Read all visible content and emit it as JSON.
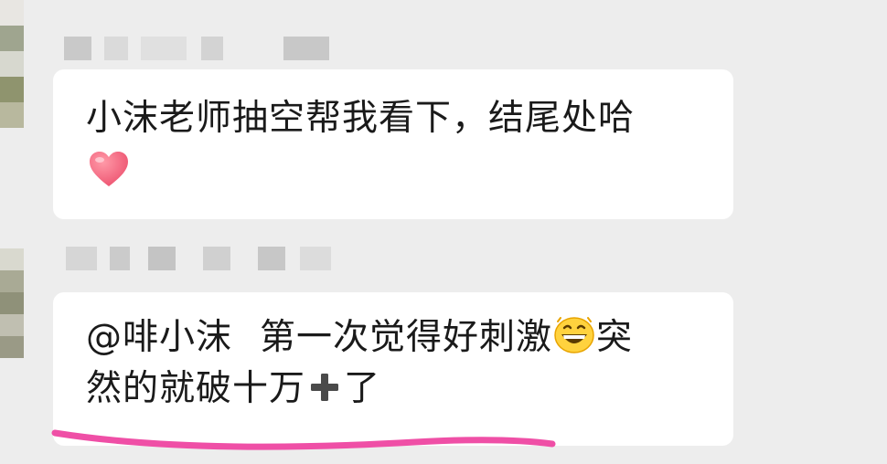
{
  "messages": [
    {
      "text": "小沫老师抽空帮我看下，结尾处哈",
      "emoji": "heart-emoji"
    },
    {
      "mention": "@啡小沫",
      "line1_before_emoji": "第一次觉得好刺激",
      "emoji": "grinning-face-emoji",
      "line1_after_emoji": "突",
      "line2_before_icon": "然的就破十万",
      "icon": "plus-icon",
      "line2_after_icon": "了"
    }
  ],
  "colors": {
    "background": "#ededed",
    "bubble": "#ffffff",
    "text": "#1a1a1a",
    "heart": "#f0607a",
    "underline": "#ef4fa6",
    "mosaic": "#cfcfcf"
  }
}
